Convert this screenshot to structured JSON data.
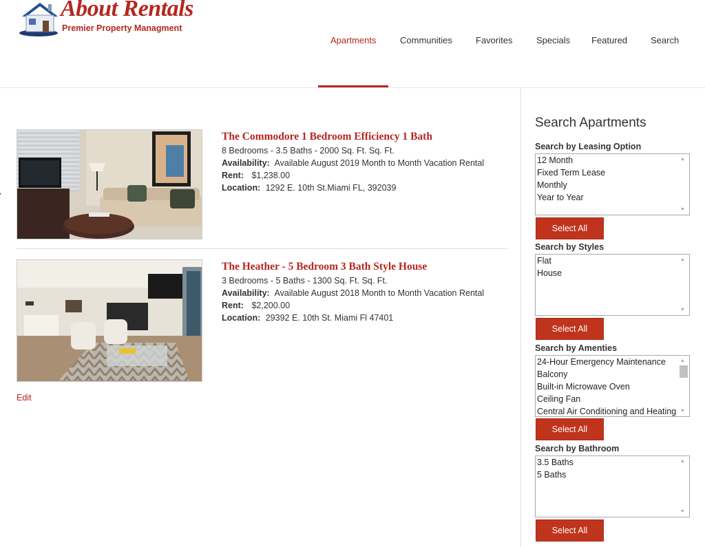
{
  "brand": {
    "name": "About Rentals",
    "tagline": "Premier Property Managment"
  },
  "nav": {
    "items": [
      {
        "label": "Apartments",
        "active": true
      },
      {
        "label": "Communities",
        "active": false
      },
      {
        "label": "Favorites",
        "active": false
      },
      {
        "label": "Specials",
        "active": false
      },
      {
        "label": "Featured",
        "active": false
      },
      {
        "label": "Search",
        "active": false
      }
    ]
  },
  "listings": [
    {
      "title": "The Commodore 1 Bedroom Efficiency 1 Bath",
      "summary": "8 Bedrooms - 3.5 Baths - 2000 Sq. Ft. Sq. Ft.",
      "availability_label": "Availability:",
      "availability": "Available August 2019 Month to Month Vacation Rental",
      "rent_label": "Rent:",
      "rent": "$1,238.00",
      "location_label": "Location:",
      "location": "1292 E. 10th St.Miami FL, 392039"
    },
    {
      "title": "The Heather - 5 Bedroom 3 Bath Style House",
      "summary": "3 Bedrooms - 5 Baths - 1300 Sq. Ft. Sq. Ft.",
      "availability_label": "Availability:",
      "availability": "Available August 2018 Month to Month Vacation Rental",
      "rent_label": "Rent:",
      "rent": "$2,200.00",
      "location_label": "Location:",
      "location": "29392 E. 10th St. Miami Fl 47401"
    }
  ],
  "edit_label": "Edit",
  "sidebar": {
    "title": "Search Apartments",
    "select_all_label": "Select All",
    "groups": [
      {
        "label": "Search by Leasing Option",
        "options": [
          "12 Month",
          "Fixed Term Lease",
          "Monthly",
          "Year to Year"
        ]
      },
      {
        "label": "Search by Styles",
        "options": [
          "Flat",
          "House"
        ]
      },
      {
        "label": "Search by Amenties",
        "options": [
          "24-Hour Emergency Maintenance",
          "Balcony",
          "Built-in Microwave Oven",
          "Ceiling Fan",
          "Central Air Conditioning and Heating"
        ]
      },
      {
        "label": "Search by Bathroom",
        "options": [
          "3.5 Baths",
          "5 Baths"
        ]
      }
    ]
  },
  "colors": {
    "accent": "#b5261e",
    "button": "#c0341d"
  }
}
